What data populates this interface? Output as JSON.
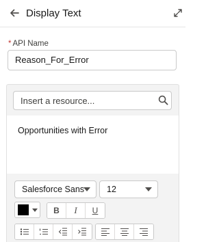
{
  "header": {
    "title": "Display Text",
    "back_icon": "arrow-left-icon",
    "expand_icon": "expand-icon"
  },
  "api_name": {
    "required_marker": "*",
    "label": "API Name",
    "value": "Reason_For_Error"
  },
  "editor": {
    "resource_placeholder": "Insert a resource...",
    "search_icon": "search-icon",
    "content": "Opportunities with Error",
    "toolbar": {
      "font_family": "Salesforce Sans",
      "font_size": "12",
      "text_color": "#000000",
      "bold": "B",
      "italic": "I",
      "underline": "U"
    }
  }
}
